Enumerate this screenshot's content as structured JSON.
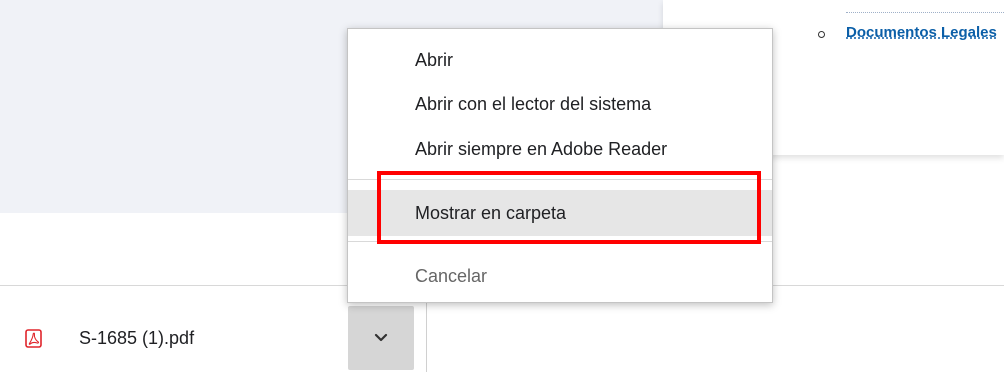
{
  "background": {
    "link_text": "Documentos Legales"
  },
  "context_menu": {
    "items": [
      {
        "label": "Abrir"
      },
      {
        "label": "Abrir con el lector del sistema"
      },
      {
        "label": "Abrir siempre en Adobe Reader"
      },
      {
        "label": "Mostrar en carpeta",
        "state": "selected"
      },
      {
        "label": "Cancelar",
        "state": "disabled"
      }
    ]
  },
  "download_shelf": {
    "file_name": "S-1685 (1).pdf",
    "file_icon": "pdf-icon",
    "menu_toggle_icon": "chevron-down-icon"
  },
  "annotation": {
    "highlight_color": "#ff0000"
  },
  "colors": {
    "link": "#0b5fa8",
    "page_panel": "#f0f2f7",
    "pdf_red": "#e0252b",
    "selected_item": "#e6e6e6"
  }
}
